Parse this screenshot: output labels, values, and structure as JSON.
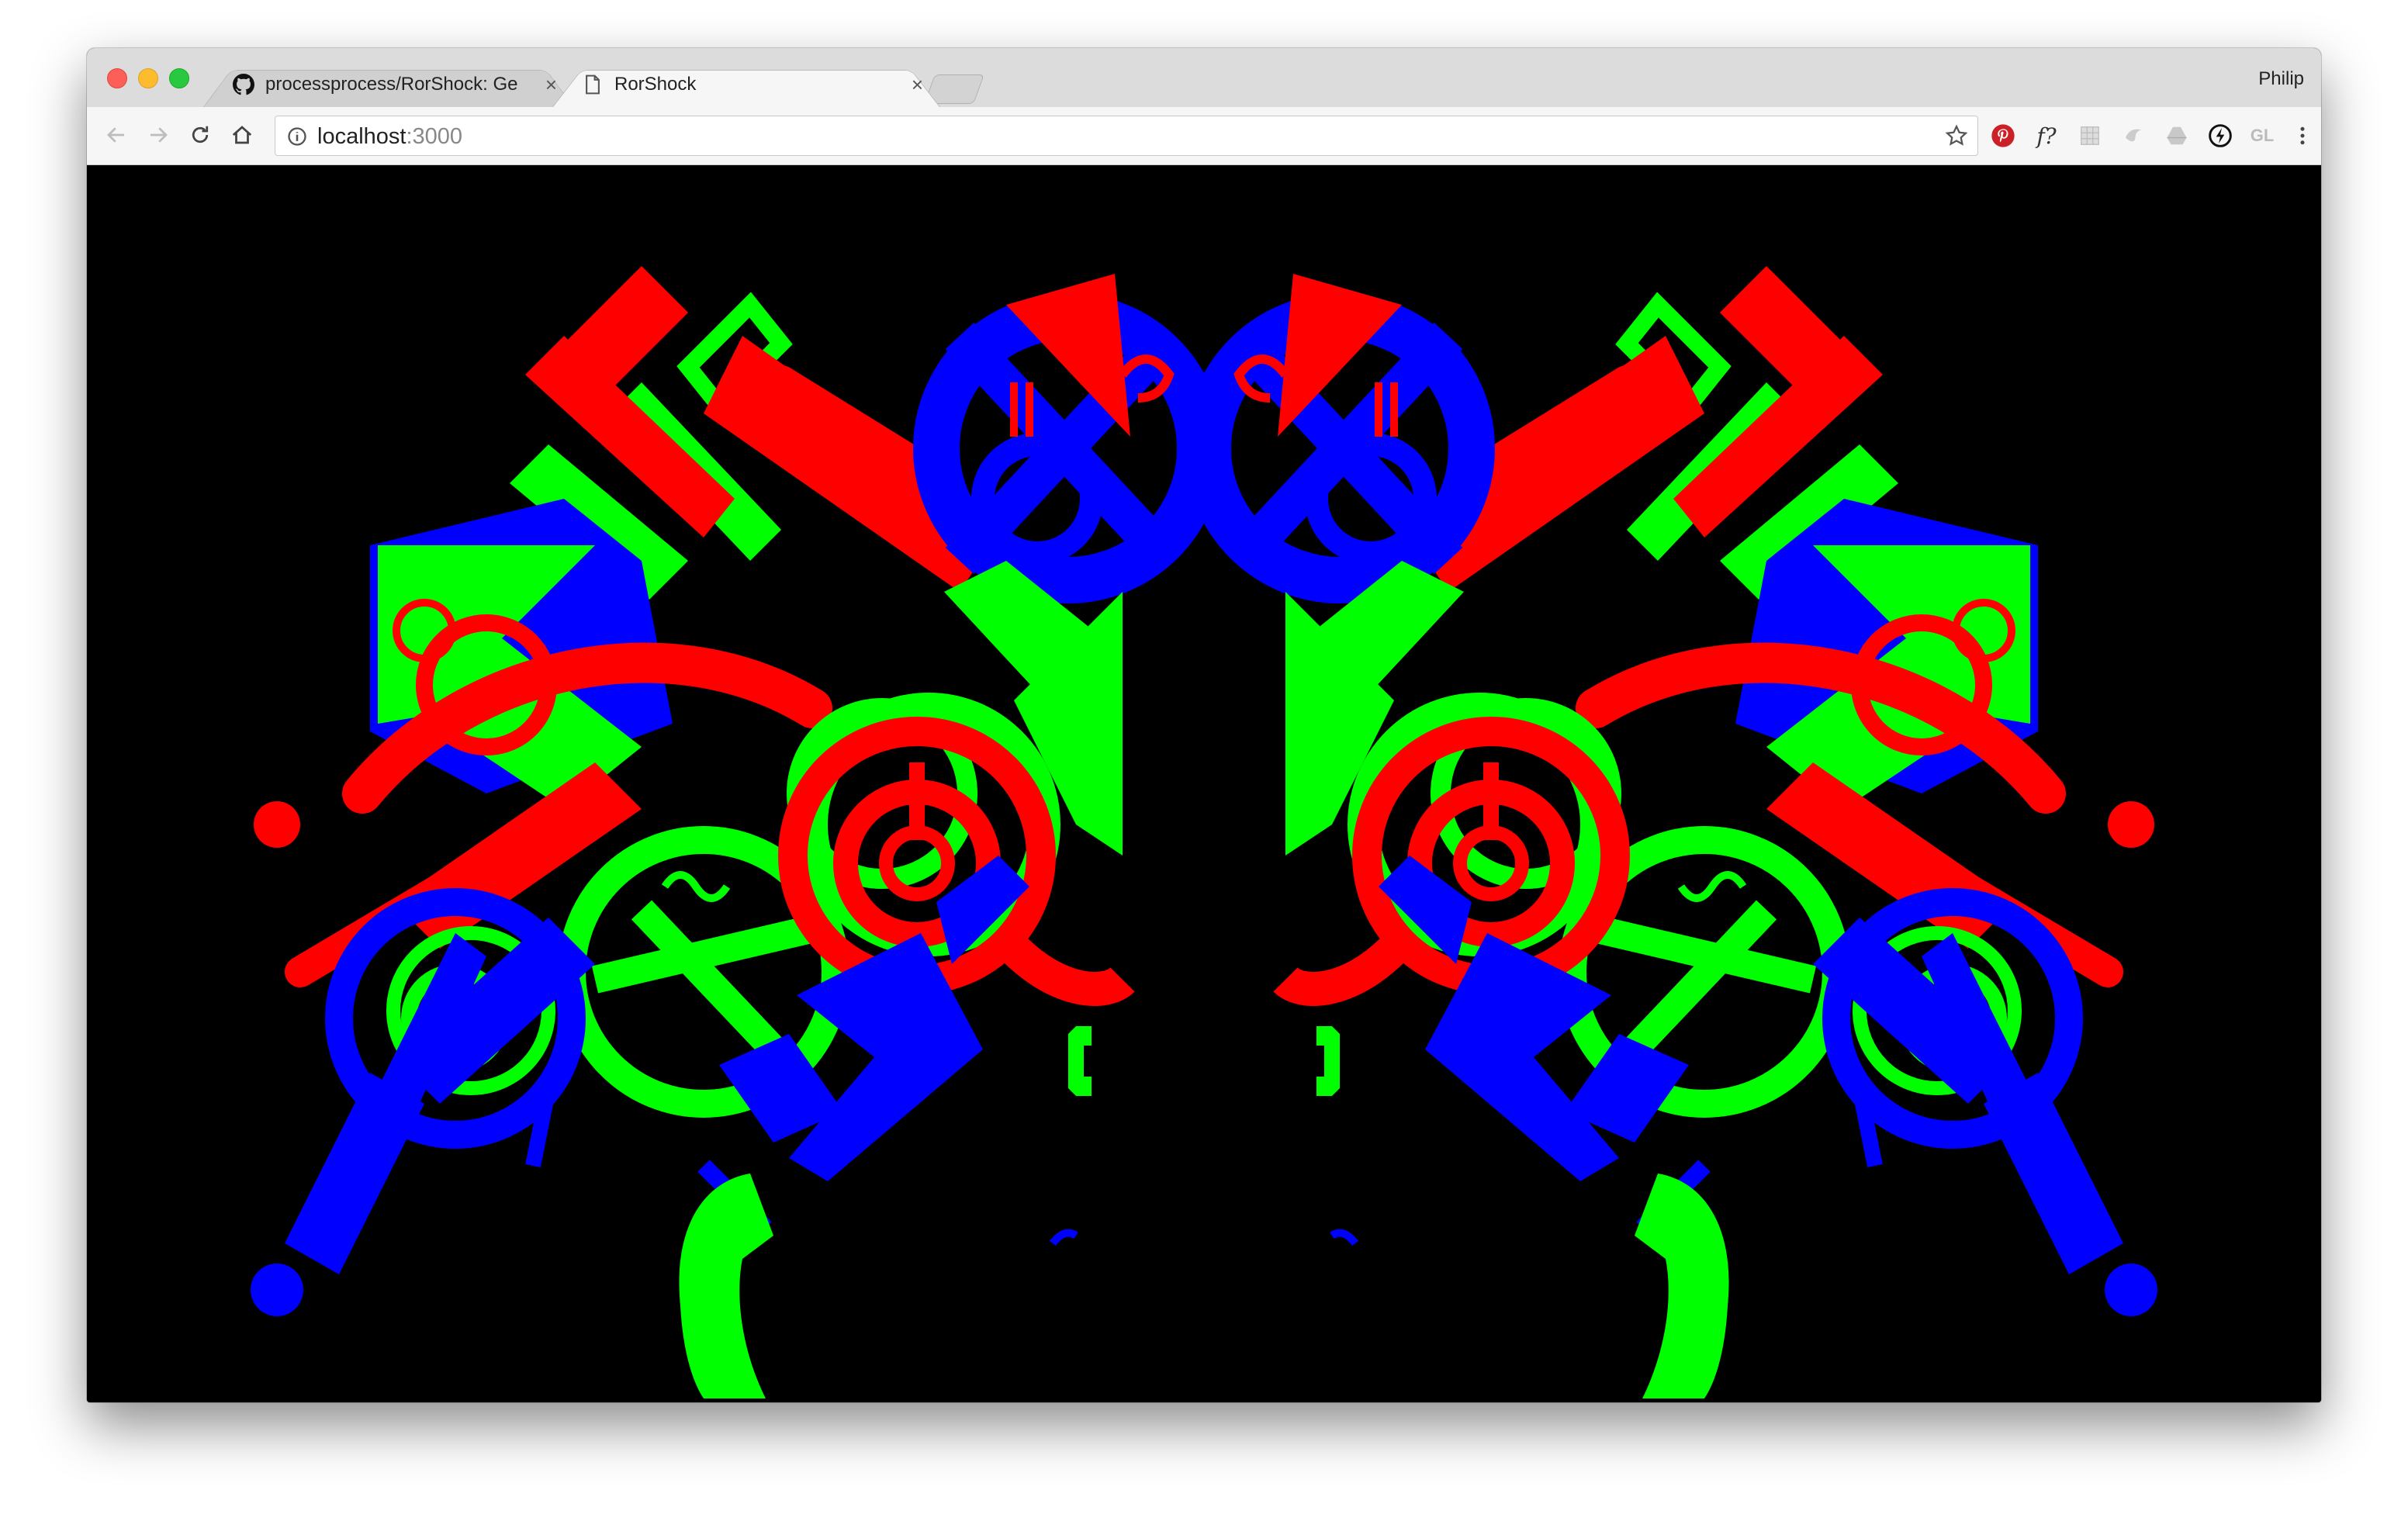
{
  "window": {
    "profile_name": "Philip"
  },
  "tabs": [
    {
      "title": "processprocess/RorShock: Ge",
      "favicon": "github-icon",
      "active": false
    },
    {
      "title": "RorShock",
      "favicon": "page-icon",
      "active": true
    }
  ],
  "toolbar": {
    "url_host": "localhost",
    "url_port": ":3000",
    "extensions": [
      "pinterest-icon",
      "whatfont-icon",
      "grid-ext-icon",
      "ext-icon-a",
      "drive-icon",
      "bolt-icon",
      "gl-icon",
      "menu-icon"
    ],
    "gl_label": "GL",
    "whatfont_label": "f?"
  },
  "page": {
    "background": "#000000",
    "palette": [
      "#ff0000",
      "#00ff00",
      "#0000ff"
    ]
  }
}
